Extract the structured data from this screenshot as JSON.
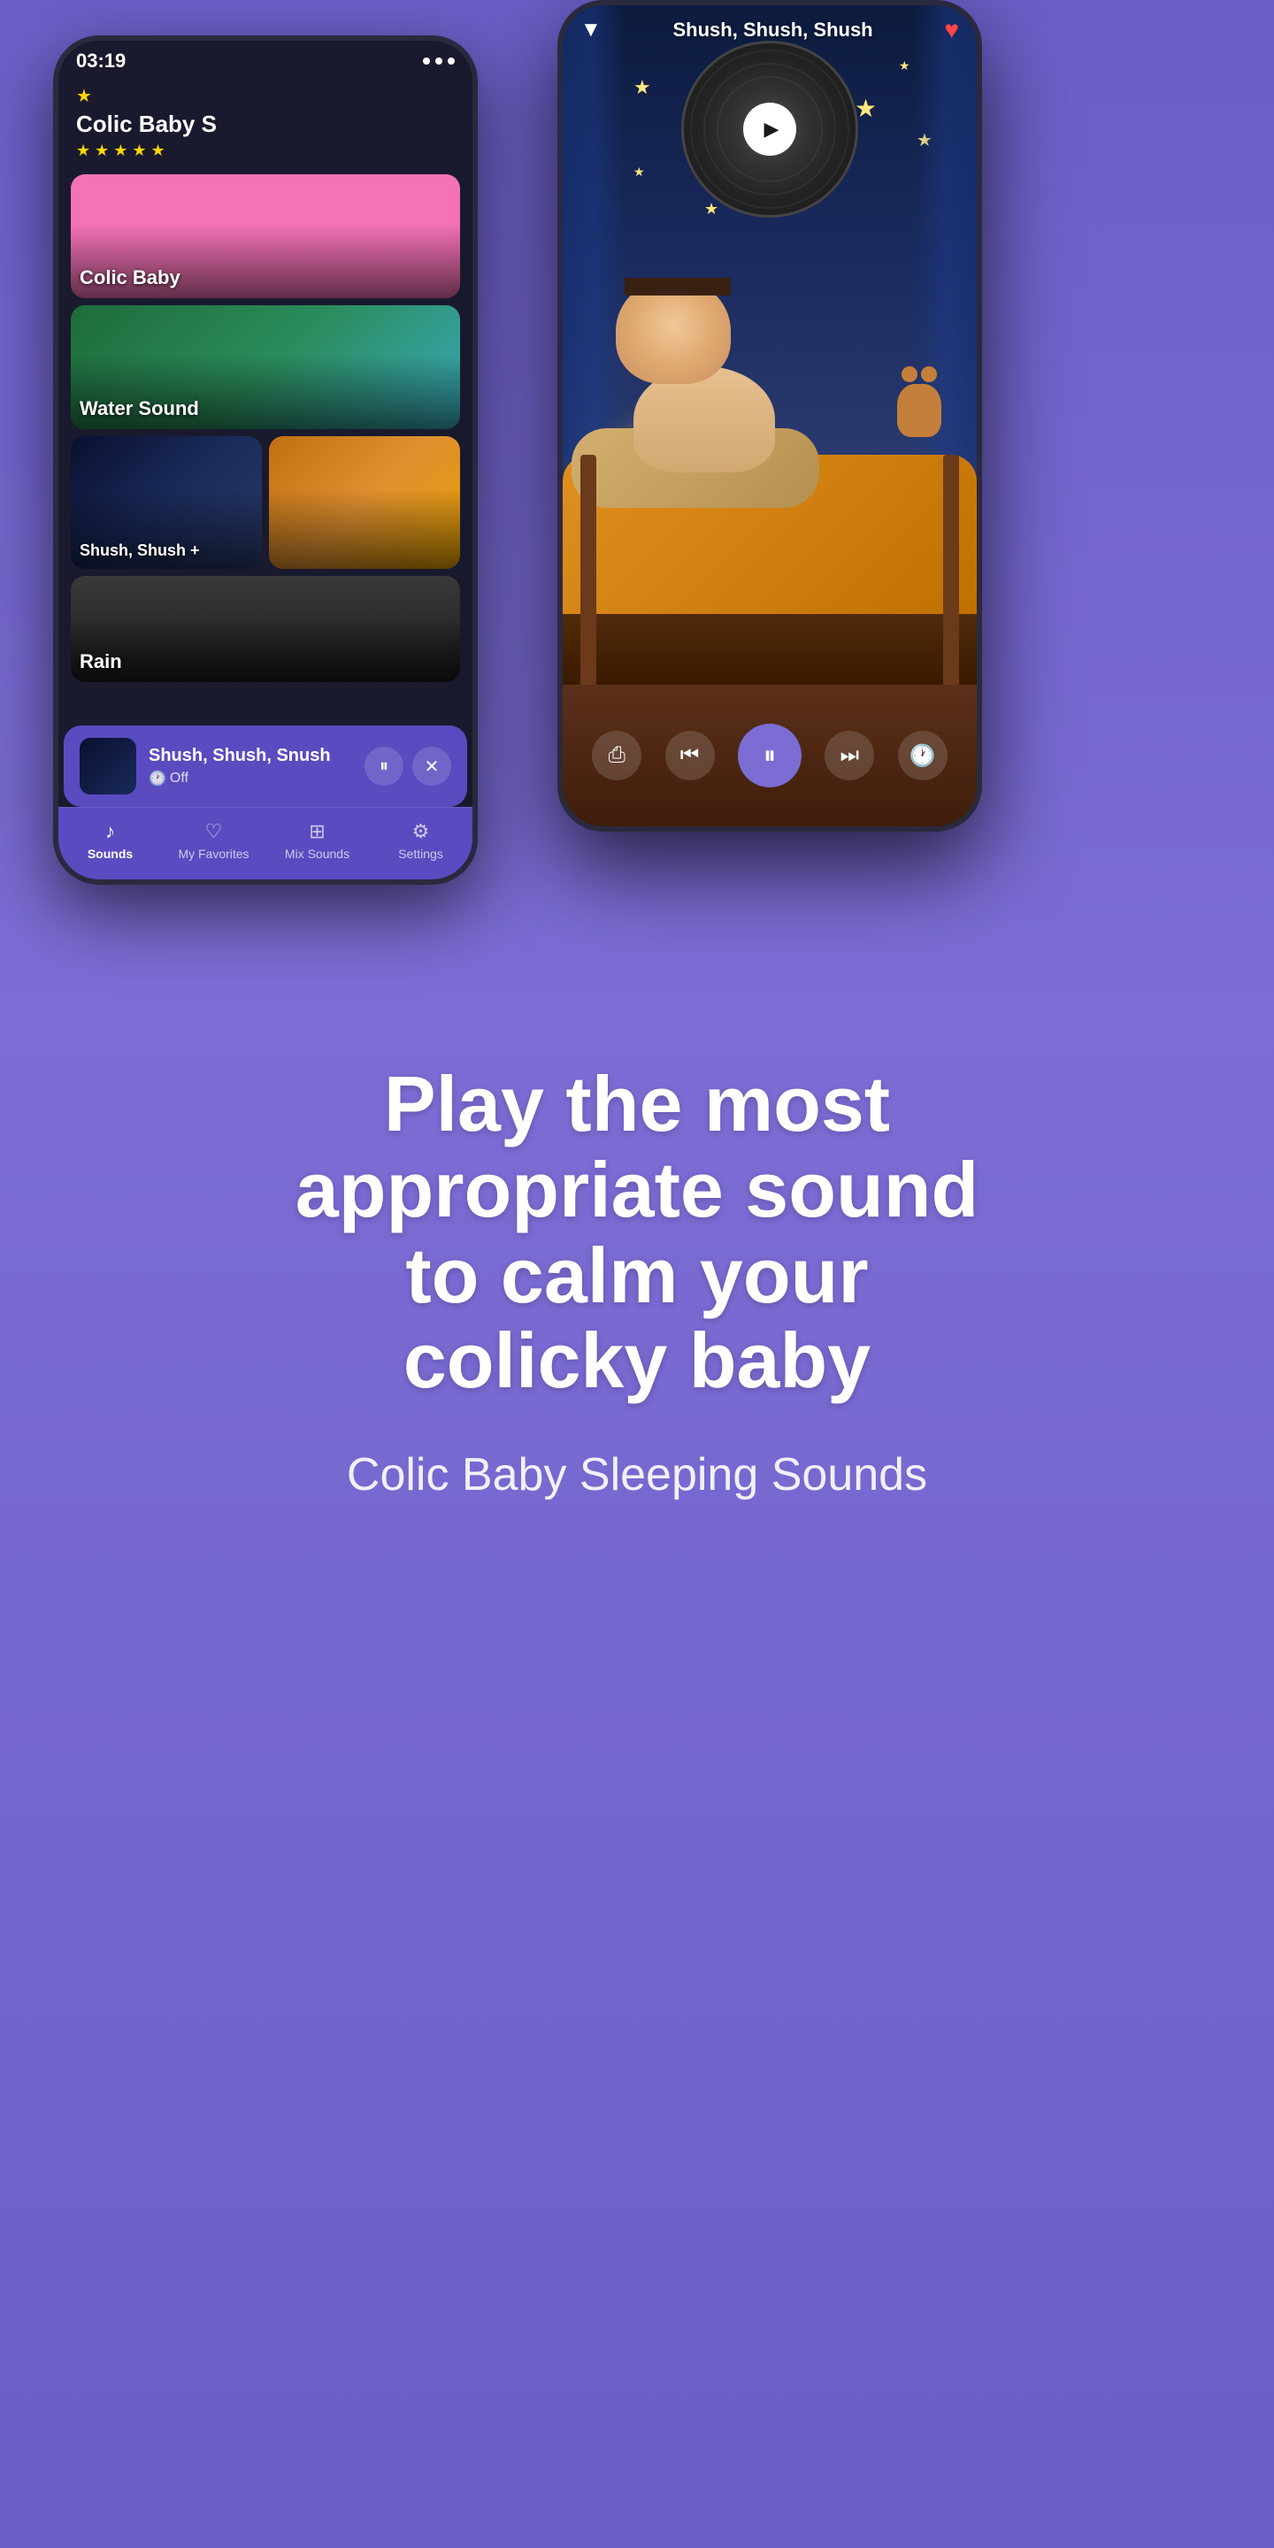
{
  "app": {
    "title": "Colic Baby Sleeping Sounds"
  },
  "back_phone": {
    "status": {
      "time": "03:19",
      "icon": "▲"
    },
    "header": {
      "star": "★",
      "title": "Colic Baby S",
      "stars": "★ ★ ★ ★ ★"
    },
    "sound_items": [
      {
        "label": "Colic Baby",
        "type": "colic"
      },
      {
        "label": "Water Sound",
        "type": "water"
      },
      {
        "label": "Shush, Shush +",
        "type": "shush-left"
      },
      {
        "label": "",
        "type": "shush-right"
      }
    ],
    "mini_player": {
      "title": "Shush, Shush, Snush",
      "timer_label": "Off",
      "timer_icon": "🕐"
    },
    "tabs": [
      {
        "label": "Sounds",
        "icon": "♪",
        "active": true
      },
      {
        "label": "My Favorites",
        "icon": "♡",
        "active": false
      },
      {
        "label": "Mix Sounds",
        "icon": "⊞",
        "active": false
      },
      {
        "label": "Settings",
        "icon": "⚙",
        "active": false
      }
    ]
  },
  "front_phone": {
    "header": {
      "title": "Shush, Shush, Shush",
      "chevron_symbol": "▼",
      "heart_symbol": "♥"
    },
    "controls": {
      "share_symbol": "⎙",
      "prev_symbol": "⏮",
      "pause_symbol": "⏸",
      "next_symbol": "⏭",
      "timer_symbol": "🕐"
    }
  },
  "text_section": {
    "heading_line1": "Play the most",
    "heading_line2": "appropriate sound",
    "heading_line3": "to calm your",
    "heading_line4": "colicky baby",
    "sub_heading": "Colic Baby Sleeping Sounds"
  }
}
